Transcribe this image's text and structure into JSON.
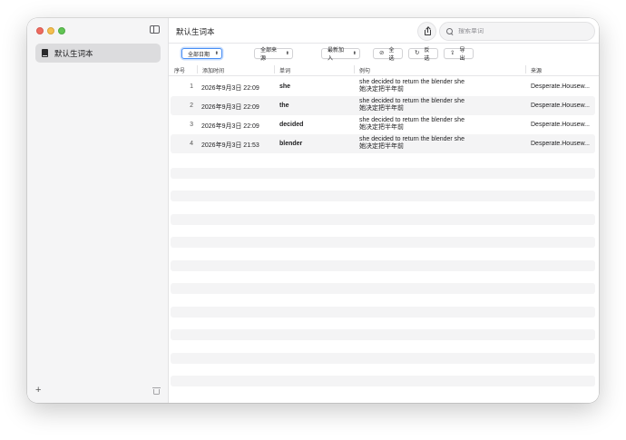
{
  "sidebar": {
    "items": [
      {
        "label": "默认生词本"
      }
    ],
    "add_label": "+"
  },
  "header": {
    "title": "默认生词本",
    "search": {
      "placeholder": "搜索单词",
      "value": ""
    }
  },
  "toolbar": {
    "date_filter": "全部日期",
    "source_filter": "全部来源",
    "sort": "最新加入",
    "select_all": "全选",
    "invert": "反选",
    "export": "导出"
  },
  "table": {
    "columns": [
      "序号",
      "添加时间",
      "单词",
      "例句",
      "来源"
    ],
    "rows": [
      {
        "index": "1",
        "time": "2026年9月3日 22:09",
        "word": "she",
        "example_en": "she decided to return the blender she",
        "example_zh": "她决定把半年前",
        "source": "Desperate.Housew..."
      },
      {
        "index": "2",
        "time": "2026年9月3日 22:09",
        "word": "the",
        "example_en": "she decided to return the blender she",
        "example_zh": "她决定把半年前",
        "source": "Desperate.Housew..."
      },
      {
        "index": "3",
        "time": "2026年9月3日 22:09",
        "word": "decided",
        "example_en": "she decided to return the blender she",
        "example_zh": "她决定把半年前",
        "source": "Desperate.Housew..."
      },
      {
        "index": "4",
        "time": "2026年9月3日 21:53",
        "word": "blender",
        "example_en": "she decided to return the blender she",
        "example_zh": "她决定把半年前",
        "source": "Desperate.Housew..."
      }
    ]
  }
}
